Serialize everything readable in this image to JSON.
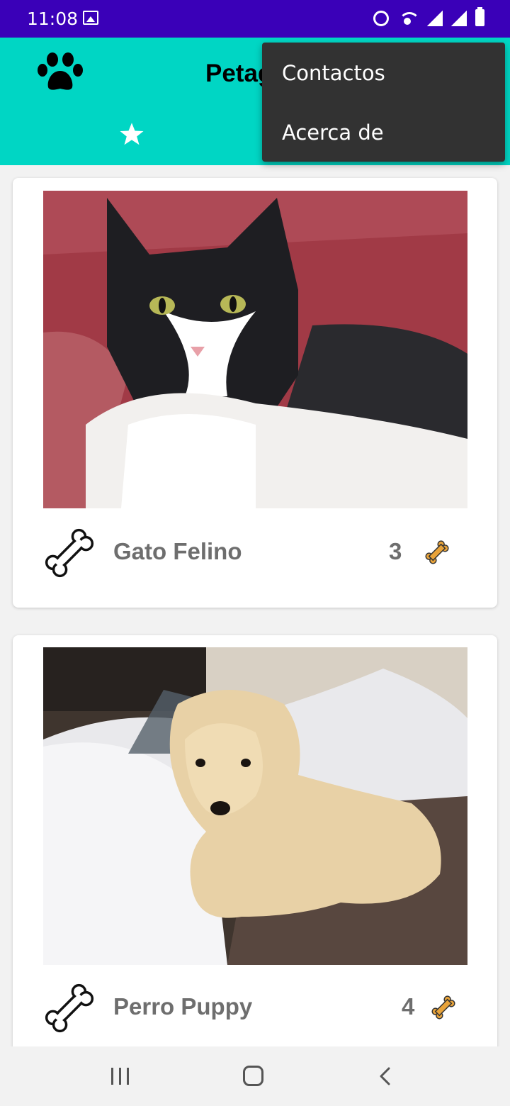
{
  "status_bar": {
    "time": "11:08"
  },
  "app_bar": {
    "title": "Petagram"
  },
  "overflow_menu": {
    "items": [
      {
        "label": "Contactos"
      },
      {
        "label": "Acerca de"
      }
    ]
  },
  "pets": [
    {
      "name": "Gato Felino",
      "rating": "3",
      "photo_icon": "cat-photo"
    },
    {
      "name": "Perro Puppy",
      "rating": "4",
      "photo_icon": "dog-photo"
    }
  ],
  "colors": {
    "status_bar": "#3a00b8",
    "app_bar": "#00d6c4",
    "menu": "#323232",
    "bone": "#e8a33a"
  },
  "icons": [
    "paw-icon",
    "star-icon",
    "bone-outline-icon",
    "bone-icon",
    "recent-apps-icon",
    "home-icon",
    "back-icon"
  ]
}
